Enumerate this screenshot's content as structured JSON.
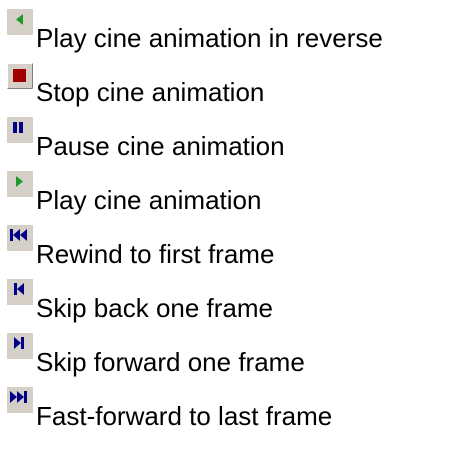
{
  "legend": {
    "items": [
      {
        "icon": "play-reverse-icon",
        "label": "Play cine animation in reverse"
      },
      {
        "icon": "stop-icon",
        "label": "Stop cine animation"
      },
      {
        "icon": "pause-icon",
        "label": "Pause cine animation"
      },
      {
        "icon": "play-icon",
        "label": "Play cine animation"
      },
      {
        "icon": "rewind-to-first-icon",
        "label": "Rewind to first frame"
      },
      {
        "icon": "skip-back-icon",
        "label": "Skip back one frame"
      },
      {
        "icon": "skip-forward-icon",
        "label": "Skip forward one frame"
      },
      {
        "icon": "fast-forward-to-last-icon",
        "label": "Fast-forward to last frame"
      }
    ]
  },
  "colors": {
    "button_face": "#d4d0c8",
    "play_green": "#1e9a2a",
    "stop_red": "#a00000",
    "transport_blue": "#000088",
    "text": "#000000"
  }
}
